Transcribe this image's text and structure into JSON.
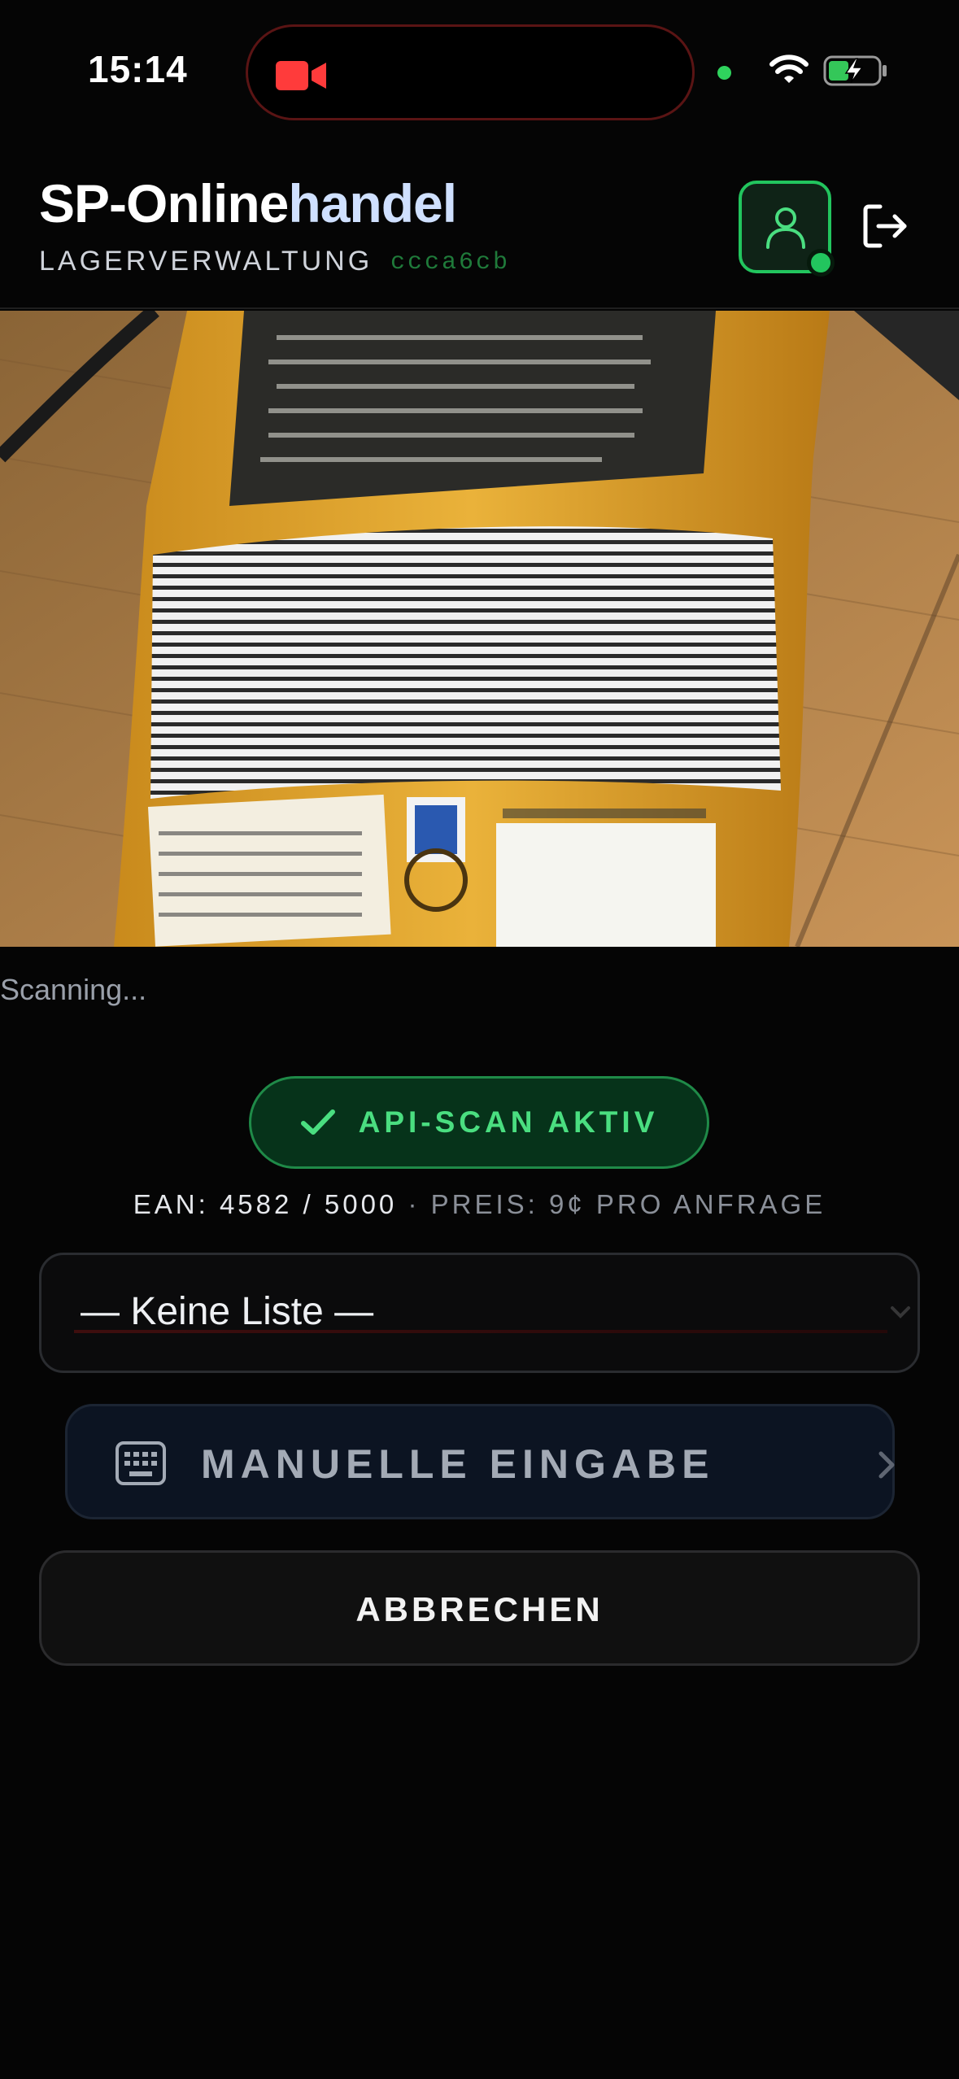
{
  "status_bar": {
    "time": "15:14"
  },
  "header": {
    "title_part1": "SP-Online",
    "title_part2": "handel",
    "subtitle": "LAGERVERWALTUNG",
    "build": "ccca6cb"
  },
  "scanner": {
    "status": "Scanning..."
  },
  "api_badge": {
    "label": "API-SCAN AKTIV"
  },
  "quota": {
    "ean": "EAN: 4582 / 5000",
    "separator": " · ",
    "price": "PREIS: 9¢ PRO ANFRAGE"
  },
  "list_select": {
    "value": "— Keine Liste —"
  },
  "manual_entry": {
    "label": "MANUELLE EINGABE"
  },
  "cancel": {
    "label": "ABBRECHEN"
  },
  "colors": {
    "accent_green": "#22c55e",
    "badge_text": "#4ade80",
    "recording_red": "#ff3b3b"
  },
  "icons": {
    "recording": "video-camera-icon",
    "wifi": "wifi-icon",
    "battery": "battery-charging-icon",
    "profile": "user-icon",
    "logout": "logout-icon",
    "check": "check-icon",
    "keyboard": "keyboard-icon",
    "chevron": "chevron-right-icon"
  }
}
